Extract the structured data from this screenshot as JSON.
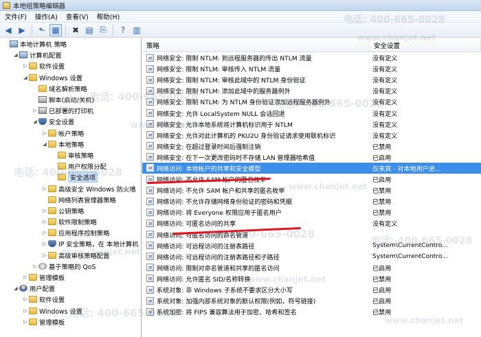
{
  "window": {
    "title": "本地组策略编辑器"
  },
  "menu": [
    "文件(F)",
    "操作(A)",
    "查看(V)",
    "帮助(H)"
  ],
  "toolbar": [
    {
      "name": "back-icon",
      "glyph": "◀"
    },
    {
      "name": "forward-icon",
      "glyph": "▶"
    },
    {
      "name": "up-folder-icon",
      "glyph": "⬑"
    },
    {
      "name": "show-tree-icon",
      "glyph": "▦"
    },
    {
      "name": "delete-icon",
      "glyph": "✖"
    },
    {
      "name": "properties-icon",
      "glyph": "▤"
    },
    {
      "name": "export-icon",
      "glyph": "⎘"
    },
    {
      "name": "help-icon",
      "glyph": "?"
    },
    {
      "name": "filter-icon",
      "glyph": "▥"
    }
  ],
  "tree": [
    {
      "label": "本地计算机 策略",
      "indent": 0,
      "icon": "computer",
      "exp": ""
    },
    {
      "label": "计算机配置",
      "indent": 1,
      "icon": "computer",
      "exp": "◢"
    },
    {
      "label": "软件设置",
      "indent": 2,
      "icon": "folder",
      "exp": "▷"
    },
    {
      "label": "Windows 设置",
      "indent": 2,
      "icon": "folder",
      "exp": "◢"
    },
    {
      "label": "域名解析策略",
      "indent": 3,
      "icon": "folder",
      "exp": ""
    },
    {
      "label": "脚本(启动/关机)",
      "indent": 3,
      "icon": "printer",
      "exp": ""
    },
    {
      "label": "已部署的打印机",
      "indent": 3,
      "icon": "printer",
      "exp": "▷"
    },
    {
      "label": "安全设置",
      "indent": 3,
      "icon": "shield",
      "exp": "◢"
    },
    {
      "label": "帐户策略",
      "indent": 4,
      "icon": "folder",
      "exp": "▷"
    },
    {
      "label": "本地策略",
      "indent": 4,
      "icon": "folder",
      "exp": "◢"
    },
    {
      "label": "审核策略",
      "indent": 5,
      "icon": "folder",
      "exp": ""
    },
    {
      "label": "用户权限分配",
      "indent": 5,
      "icon": "folder",
      "exp": ""
    },
    {
      "label": "安全选项",
      "indent": 5,
      "icon": "folder",
      "exp": "",
      "highlight": true
    },
    {
      "label": "高级安全 Windows 防火墙",
      "indent": 4,
      "icon": "folder",
      "exp": "▷"
    },
    {
      "label": "网络列表管理器策略",
      "indent": 4,
      "icon": "folder",
      "exp": ""
    },
    {
      "label": "公钥策略",
      "indent": 4,
      "icon": "folder",
      "exp": "▷"
    },
    {
      "label": "软件限制策略",
      "indent": 4,
      "icon": "folder",
      "exp": "▷"
    },
    {
      "label": "应用程序控制策略",
      "indent": 4,
      "icon": "folder",
      "exp": "▷"
    },
    {
      "label": "IP 安全策略，在 本地计算机",
      "indent": 4,
      "icon": "shield",
      "exp": "▷"
    },
    {
      "label": "高级审核策略配置",
      "indent": 4,
      "icon": "folder",
      "exp": "▷"
    },
    {
      "label": "基于策略的 QoS",
      "indent": 3,
      "icon": "gear",
      "exp": "▷"
    },
    {
      "label": "管理模板",
      "indent": 2,
      "icon": "folder",
      "exp": "▷"
    },
    {
      "label": "用户配置",
      "indent": 1,
      "icon": "user",
      "exp": "◢"
    },
    {
      "label": "软件设置",
      "indent": 2,
      "icon": "folder",
      "exp": "▷"
    },
    {
      "label": "Windows 设置",
      "indent": 2,
      "icon": "folder",
      "exp": "▷"
    },
    {
      "label": "管理模板",
      "indent": 2,
      "icon": "folder",
      "exp": "▷"
    }
  ],
  "list": {
    "columns": [
      "策略",
      "安全设置"
    ],
    "rows": [
      {
        "policy": "网络安全: 限制 NTLM: 到远程服务器的传出 NTLM 流量",
        "setting": "没有定义"
      },
      {
        "policy": "网络安全: 限制 NTLM: 审核传入 NTLM 流量",
        "setting": "没有定义"
      },
      {
        "policy": "网络安全: 限制 NTLM: 审核此域中的 NTLM 身份验证",
        "setting": "没有定义"
      },
      {
        "policy": "网络安全: 限制 NTLM: 添加此域中的服务器例外",
        "setting": "没有定义"
      },
      {
        "policy": "网络安全: 限制 NTLM: 为 NTLM 身份验证添加远程服务器例外",
        "setting": "没有定义"
      },
      {
        "policy": "网络安全: 允许 LocalSystem NULL 会话回退",
        "setting": "没有定义"
      },
      {
        "policy": "网络安全: 允许本地系统将计算机标识用于 NTLM",
        "setting": "没有定义"
      },
      {
        "policy": "网络安全: 允许对此计算机的 PKU2U 身份验证请求使用联机标识",
        "setting": "没有定义"
      },
      {
        "policy": "网络安全: 在超过登录时间后强制注销",
        "setting": "已禁用"
      },
      {
        "policy": "网络安全: 在下一次更改密码时不存储 LAN 管理器哈希值",
        "setting": "已启用"
      },
      {
        "policy": "网络访问: 本地帐户的共享和安全模型",
        "setting": "仅来宾 - 对本地用户进...",
        "selected": true
      },
      {
        "policy": "网络访问: 不允许 SAM 帐户的匿名枚举",
        "setting": "已启用"
      },
      {
        "policy": "网络访问: 不允许 SAM 帐户和共享的匿名枚举",
        "setting": "已禁用"
      },
      {
        "policy": "网络访问: 不允许存储网络身份验证的密码和凭据",
        "setting": "已禁用"
      },
      {
        "policy": "网络访问: 将 Everyone 权限应用于匿名用户",
        "setting": "已禁用"
      },
      {
        "policy": "网络访问: 可匿名访问的共享",
        "setting": "没有定义"
      },
      {
        "policy": "网络访问: 可匿名访问的命名管道",
        "setting": ""
      },
      {
        "policy": "网络访问: 可远程访问的注册表路径",
        "setting": "System\\CurrentContro..."
      },
      {
        "policy": "网络访问: 可远程访问的注册表路径和子路径",
        "setting": "System\\CurrentContro..."
      },
      {
        "policy": "网络访问: 限制对命名管道和共享的匿名访问",
        "setting": "已启用"
      },
      {
        "policy": "网络访问: 允许匿名 SID/名称转换",
        "setting": "已禁用"
      },
      {
        "policy": "系统对象: 非 Windows 子系统不要求区分大小写",
        "setting": "已启用"
      },
      {
        "policy": "系统对象: 加强内部系统对象的默认权限(例如，符号链接)",
        "setting": "已启用"
      },
      {
        "policy": "系统加密: 将 FIPS 兼容算法用于加密、哈希和签名",
        "setting": "已禁用"
      }
    ]
  },
  "watermark": {
    "phone": "电话: 400-665-0028",
    "site": "www.chanjet.net"
  }
}
